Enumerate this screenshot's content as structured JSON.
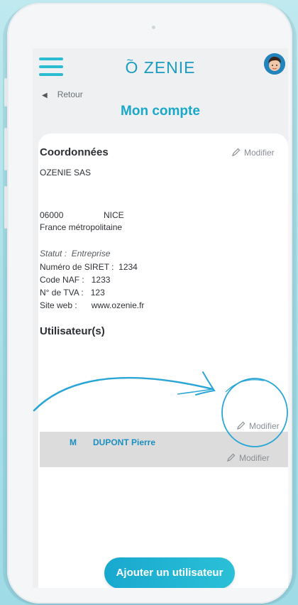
{
  "header": {
    "logo_text": "ZENIE",
    "logo_letter": "O",
    "logo_tilde": "~"
  },
  "nav": {
    "back_label": "Retour"
  },
  "page": {
    "title": "Mon compte"
  },
  "coordonnees": {
    "title": "Coordonnées",
    "modify_label": "Modifier",
    "company": "OZENIE SAS",
    "postal_code": "06000",
    "city": "NICE",
    "region": "France métropolitaine",
    "status_label": "Statut :",
    "status_value": "Entreprise",
    "siret_label": "Numéro de SIRET :",
    "siret_value": "1234",
    "naf_label": "Code NAF :",
    "naf_value": "1233",
    "tva_label": "N° de TVA :",
    "tva_value": "123",
    "web_label": "Site web :",
    "web_value": "www.ozenie.fr"
  },
  "users": {
    "title": "Utilisateur(s)",
    "ghost_modify_label": "Modifier",
    "rows": [
      {
        "civility": "M",
        "name": "DUPONT Pierre",
        "modify_label": "Modifier"
      }
    ]
  },
  "actions": {
    "add_user_label": "Ajouter un utilisateur"
  },
  "colors": {
    "accent": "#1aa8c9",
    "button_gradient_start": "#18a8cf",
    "button_gradient_end": "#2bc0d7",
    "annotation": "#2aa6d6"
  }
}
